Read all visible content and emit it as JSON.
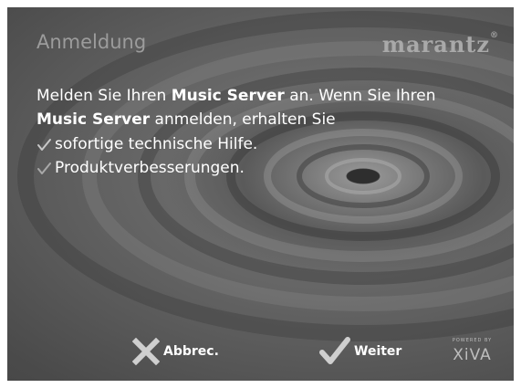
{
  "screen": {
    "title": "Anmeldung",
    "brand": "marantz",
    "message": {
      "line1_part1": "Melden Sie Ihren ",
      "line1_bold": "Music Server",
      "line1_part2": " an. Wenn Sie Ihren",
      "line2_bold": "Music Server",
      "line2_part2": " anmelden, erhalten Sie"
    },
    "bullets": [
      "sofortige technische Hilfe.",
      "Produktverbesserungen."
    ]
  },
  "buttons": {
    "cancel_label": "Abbrec.",
    "next_label": "Weiter"
  },
  "footer": {
    "powered_by": "POWERED BY",
    "logo_text": "XiVA"
  },
  "colors": {
    "background": "#5a5a5a",
    "text": "#ffffff",
    "muted": "#9c9c9c",
    "check": "#c8c8c8"
  },
  "icons": [
    "check-icon",
    "close-icon",
    "checkmark-icon"
  ]
}
